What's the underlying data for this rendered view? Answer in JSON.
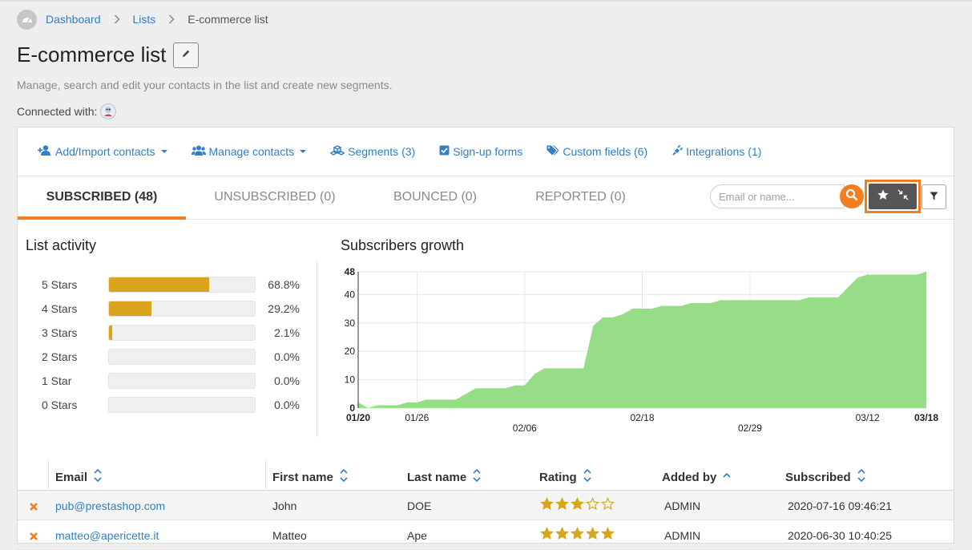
{
  "breadcrumb": {
    "home_icon": "dashboard-gauge-icon",
    "dashboard": "Dashboard",
    "lists": "Lists",
    "current": "E-commerce list"
  },
  "page": {
    "title": "E-commerce list",
    "subtitle": "Manage, search and edit your contacts in the list and create new segments.",
    "connected_label": "Connected with:"
  },
  "actions": {
    "add_import": "Add/Import contacts",
    "manage": "Manage contacts",
    "segments": "Segments (3)",
    "signup_forms": "Sign-up forms",
    "custom_fields": "Custom fields (6)",
    "integrations": "Integrations (1)"
  },
  "tabs": {
    "subscribed": "SUBSCRIBED (48)",
    "unsubscribed": "UNSUBSCRIBED (0)",
    "bounced": "BOUNCED (0)",
    "reported": "REPORTED (0)"
  },
  "search": {
    "placeholder": "Email or name..."
  },
  "colors": {
    "accent": "#f57c1f",
    "link": "#2f7fc9",
    "bar": "#d9a31b",
    "growth": "#97dc87"
  },
  "list_activity": {
    "title": "List activity",
    "rows": [
      {
        "label": "5 Stars",
        "pct_text": "68.8%",
        "fraction": 0.688
      },
      {
        "label": "4 Stars",
        "pct_text": "29.2%",
        "fraction": 0.292
      },
      {
        "label": "3 Stars",
        "pct_text": "2.1%",
        "fraction": 0.021
      },
      {
        "label": "2 Stars",
        "pct_text": "0.0%",
        "fraction": 0.0
      },
      {
        "label": "1 Star",
        "pct_text": "0.0%",
        "fraction": 0.0
      },
      {
        "label": "0 Stars",
        "pct_text": "0.0%",
        "fraction": 0.0
      }
    ]
  },
  "growth": {
    "title": "Subscribers growth"
  },
  "chart_data": {
    "type": "area",
    "title": "Subscribers growth",
    "x_start": "01/20",
    "x_end": "03/18",
    "x_ticks": [
      "01/20",
      "01/26",
      "02/06",
      "02/18",
      "02/29",
      "03/12",
      "03/18"
    ],
    "y_ticks": [
      0,
      10,
      20,
      30,
      40,
      48
    ],
    "ylim": [
      0,
      48
    ],
    "grid": true,
    "points": [
      [
        "01/20",
        2
      ],
      [
        "01/21",
        0
      ],
      [
        "01/22",
        1
      ],
      [
        "01/24",
        1
      ],
      [
        "01/25",
        2
      ],
      [
        "01/26",
        2
      ],
      [
        "01/27",
        3
      ],
      [
        "01/30",
        3
      ],
      [
        "01/31",
        5
      ],
      [
        "02/01",
        7
      ],
      [
        "02/03",
        7
      ],
      [
        "02/04",
        7
      ],
      [
        "02/05",
        8
      ],
      [
        "02/06",
        8
      ],
      [
        "02/07",
        12
      ],
      [
        "02/08",
        14
      ],
      [
        "02/09",
        14
      ],
      [
        "02/12",
        14
      ],
      [
        "02/13",
        29
      ],
      [
        "02/14",
        32
      ],
      [
        "02/15",
        32
      ],
      [
        "02/16",
        33
      ],
      [
        "02/17",
        35
      ],
      [
        "02/18",
        35
      ],
      [
        "02/19",
        35
      ],
      [
        "02/20",
        36
      ],
      [
        "02/22",
        36
      ],
      [
        "02/23",
        37
      ],
      [
        "02/25",
        37
      ],
      [
        "02/26",
        38
      ],
      [
        "03/01",
        38
      ],
      [
        "03/05",
        38
      ],
      [
        "03/06",
        39
      ],
      [
        "03/09",
        39
      ],
      [
        "03/11",
        46
      ],
      [
        "03/12",
        47
      ],
      [
        "03/16",
        47
      ],
      [
        "03/17",
        47
      ],
      [
        "03/18",
        48
      ]
    ]
  },
  "table": {
    "headers": {
      "email": "Email",
      "first": "First name",
      "last": "Last name",
      "rating": "Rating",
      "added_by": "Added by",
      "subscribed": "Subscribed"
    },
    "rows": [
      {
        "email": "pub@prestashop.com",
        "first": "John",
        "last": "DOE",
        "rating": 3,
        "added_by": "ADMIN",
        "subscribed": "2020-07-16 09:46:21"
      },
      {
        "email": "matteo@apericette.it",
        "first": "Matteo",
        "last": "Ape",
        "rating": 5,
        "added_by": "ADMIN",
        "subscribed": "2020-06-30 10:40:25"
      }
    ]
  }
}
